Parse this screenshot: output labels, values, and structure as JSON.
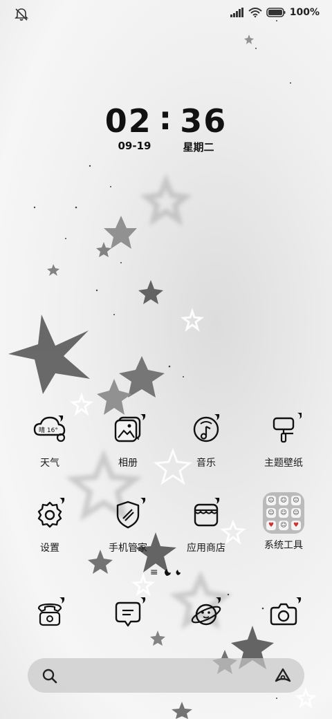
{
  "status_bar": {
    "left_icon": "bell-muted-icon",
    "signal_icon": "cellular-signal-icon",
    "wifi_icon": "wifi-icon",
    "battery_icon": "battery-icon",
    "battery_label": "100%"
  },
  "clock": {
    "hours": "02",
    "minutes": "36",
    "date": "09-19",
    "weekday": "星期二"
  },
  "home_apps": [
    {
      "label": "天气",
      "icon": "weather-icon",
      "badge": "晴 16°"
    },
    {
      "label": "相册",
      "icon": "gallery-icon"
    },
    {
      "label": "音乐",
      "icon": "music-icon"
    },
    {
      "label": "主题壁纸",
      "icon": "theme-brush-icon"
    },
    {
      "label": "设置",
      "icon": "gear-icon"
    },
    {
      "label": "手机管家",
      "icon": "shield-icon"
    },
    {
      "label": "应用商店",
      "icon": "store-icon"
    },
    {
      "label": "系统工具",
      "icon": "folder-icon"
    }
  ],
  "page_indicator": "≡",
  "dock": [
    {
      "icon": "phone-icon"
    },
    {
      "icon": "message-icon"
    },
    {
      "icon": "browser-planet-icon"
    },
    {
      "icon": "camera-icon"
    }
  ],
  "search_bar": {
    "search_icon": "search-icon",
    "assistant_icon": "assistant-icon"
  }
}
